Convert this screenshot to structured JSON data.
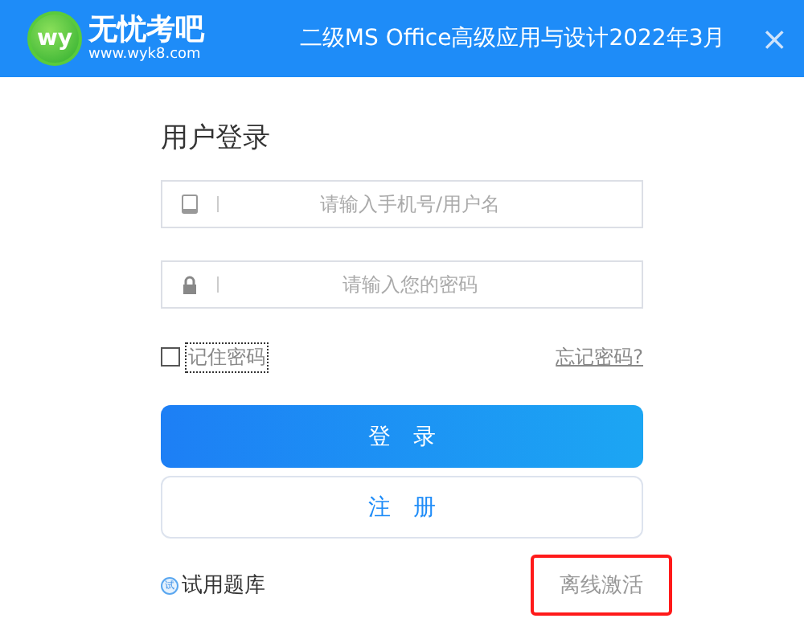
{
  "header": {
    "logo_mark": "wy",
    "logo_name": "无忧考吧",
    "logo_url": "www.wyk8.com",
    "title": "二级MS Office高级应用与设计2022年3月",
    "close": "×"
  },
  "login": {
    "heading": "用户登录",
    "fields": [
      {
        "kind": "phone",
        "placeholder": "请输入手机号/用户名"
      },
      {
        "kind": "lock",
        "placeholder": "请输入您的密码"
      }
    ],
    "remember": {
      "label": "记住密码",
      "checked": false
    },
    "forgot": "忘记密码?",
    "login_button": "登　录",
    "register_button": "注　册",
    "trial": {
      "badge": "试",
      "label": "试用题库"
    },
    "offline": {
      "label": "离线激活",
      "highlighted": true
    }
  }
}
